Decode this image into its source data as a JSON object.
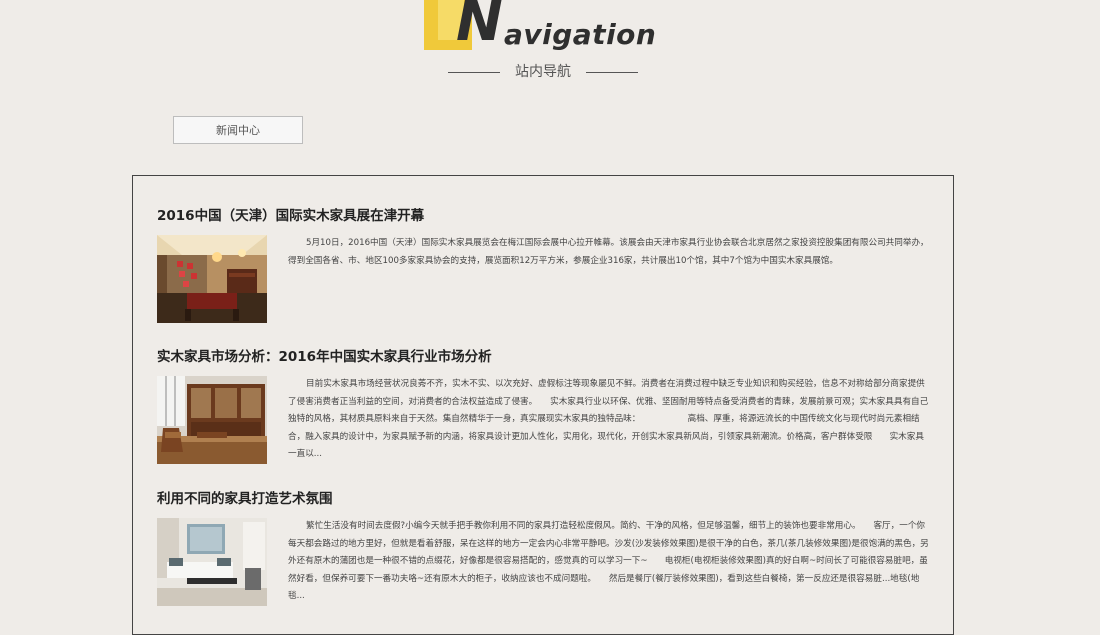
{
  "header": {
    "logo_first_letter": "N",
    "logo_rest": "avigation",
    "subtitle": "站内导航"
  },
  "category": {
    "button_label": "新闻中心"
  },
  "articles": [
    {
      "title": "2016中国（天津）国际实木家具展在津开幕",
      "summary": "5月10日，2016中国（天津）国际实木家具展览会在梅江国际会展中心拉开帷幕。该展会由天津市家具行业协会联合北京居然之家投资控股集团有限公司共同举办，得到全国各省、市、地区100多家家具协会的支持，展览面积12万平方米，参展企业316家，共计展出10个馆，其中7个馆为中国实木家具展馆。",
      "image": "showroom-photo"
    },
    {
      "title": "实木家具市场分析：2016年中国实木家具行业市场分析",
      "summary": "目前实木家具市场经营状况良莠不齐，实木不实、以次充好、虚假标注等现象屡见不鲜。消费者在消费过程中缺乏专业知识和购买经验，信息不对称给部分商家提供了侵害消费者正当利益的空间，对消费者的合法权益造成了侵害。　　实木家具行业以环保、优雅、坚固耐用等特点备受消费者的青睐，发展前景可观；实木家具具有自己独特的风格，其材质具原料来自于天然。集自然精华于一身，真实展现实木家具的独特品味：　　　　　　高档、厚重，将源远流长的中国传统文化与现代时尚元素相结合，融入家具的设计中，为家具赋予新的内涵，将家具设计更加人性化，实用化，现代化，开创实木家具新风尚，引领家具新潮流。价格高，客户群体受限　　实木家具一直以...",
      "image": "cabinet-room-photo"
    },
    {
      "title": "利用不同的家具打造艺术氛围",
      "summary": "繁忙生活没有时间去度假?小编今天就手把手教你利用不同的家具打造轻松度假风。简约、干净的风格，但足够温馨，细节上的装饰也要非常用心。　　客厅，一个你每天都会路过的地方里好，但就是看着舒服，呆在这样的地方一定会内心非常平静吧。沙发(沙发装修效果图)是很干净的白色，茶几(茶几装修效果图)是很饱满的黑色，另外还有原木的蒲团也是一种很不错的点缀花，好像都是很容易搭配的，感觉真的可以学习一下~　　电视柜(电视柜装修效果图)真的好白啊~时间长了可能很容易脏吧，虽然好看，但保养可要下一番功夫咯~还有原木大的柜子，收纳应该也不成问题啦。　　然后是餐厅(餐厅装修效果图)，看到这些白餐椅，第一反应还是很容易脏...地毯(地毯...",
      "image": "living-room-photo"
    }
  ],
  "colors": {
    "background": "#efece8",
    "logo_yellow": "#f0c93a",
    "logo_text": "#2f2f2f",
    "panel_border": "#444444"
  }
}
